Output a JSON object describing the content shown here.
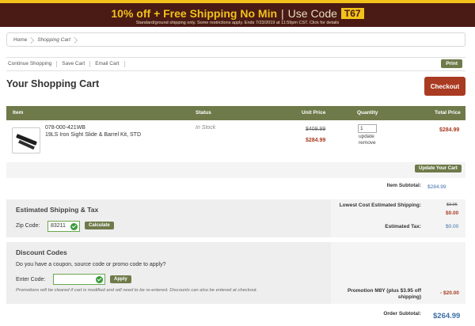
{
  "promo": {
    "headline": "10% off + Free Shipping No Min",
    "separator": "|",
    "use_code_label": "Use Code",
    "code": "T67",
    "subtext": "Standard/ground shipping only. Some restrictions apply. Ends 7/23/2019 at 11:59pm CST. Click for details"
  },
  "breadcrumb": [
    "Home",
    "Shopping Cart"
  ],
  "actions": {
    "continue": "Continue Shopping",
    "save": "Save Cart",
    "email": "Email Cart",
    "print": "Print"
  },
  "cart": {
    "title": "Your Shopping Cart",
    "checkout": "Checkout"
  },
  "table": {
    "headers": {
      "item": "Item",
      "status": "Status",
      "unit_price": "Unit Price",
      "quantity": "Quantity",
      "total_price": "Total Price"
    },
    "rows": [
      {
        "sku": "078-000-421WB",
        "description": "19LS Iron Sight Slide & Barrel Kit, STD",
        "status": "In Stock",
        "old_price": "$409.99",
        "price": "$284.99",
        "qty": "1",
        "update": "update",
        "remove": "remove",
        "total": "$284.99"
      }
    ],
    "update_button": "Update Your Cart"
  },
  "totals": {
    "item_subtotal_label": "Item Subtotal:",
    "item_subtotal": "$284.99",
    "shipping_label": "Lowest Cost Estimated Shipping:",
    "shipping_old": "$3.95",
    "shipping_new": "$0.00",
    "tax_label": "Estimated Tax:",
    "tax": "$0.00",
    "promotion_label": "Promotion M8Y (plus $3.95 off shipping)",
    "promotion_value": "- $20.00",
    "order_subtotal_label": "Order Subtotal:",
    "order_subtotal": "$264.99"
  },
  "shipping": {
    "title": "Estimated Shipping & Tax",
    "zip_label": "Zip Code:",
    "zip_value": "83211",
    "calculate": "Calculate"
  },
  "discount": {
    "title": "Discount Codes",
    "question": "Do you have a coupon, source code or promo code to apply?",
    "code_label": "Enter Code:",
    "code_value": "",
    "apply": "Apply",
    "note": "Promotions will be cleared if cart is modified and will need to be re-entered. Discounts can also be entered at checkout."
  }
}
